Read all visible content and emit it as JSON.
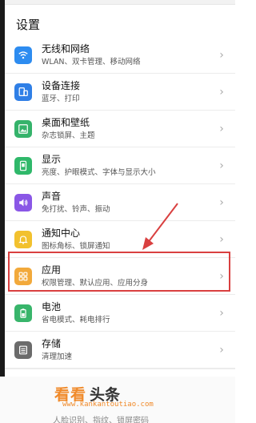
{
  "header": {
    "title": "设置"
  },
  "items": [
    {
      "title": "无线和网络",
      "sub": "WLAN、双卡管理、移动网络",
      "color": "#2d8cf0",
      "icon": "wifi-icon"
    },
    {
      "title": "设备连接",
      "sub": "蓝牙、打印",
      "color": "#2f7fe6",
      "icon": "device-connect-icon"
    },
    {
      "title": "桌面和壁纸",
      "sub": "杂志锁屏、主题",
      "color": "#35b36b",
      "icon": "wallpaper-icon"
    },
    {
      "title": "显示",
      "sub": "亮度、护眼模式、字体与显示大小",
      "color": "#2fb86a",
      "icon": "display-icon"
    },
    {
      "title": "声音",
      "sub": "免打扰、铃声、振动",
      "color": "#8a57e6",
      "icon": "sound-icon"
    },
    {
      "title": "通知中心",
      "sub": "图标角标、锁屏通知",
      "color": "#f2c12e",
      "icon": "bell-icon"
    },
    {
      "title": "应用",
      "sub": "权限管理、默认应用、应用分身",
      "color": "#f2a93b",
      "icon": "apps-grid-icon"
    },
    {
      "title": "电池",
      "sub": "省电模式、耗电排行",
      "color": "#38b56b",
      "icon": "battery-icon"
    },
    {
      "title": "存储",
      "sub": "清理加速",
      "color": "#6b6b6b",
      "icon": "storage-icon"
    }
  ],
  "watermark": {
    "main": "看看",
    "side": "头条",
    "url": "www.kankantoutiao.com"
  },
  "bottom": {
    "cut_text": "人脸识别、指纹、锁屏密码"
  }
}
